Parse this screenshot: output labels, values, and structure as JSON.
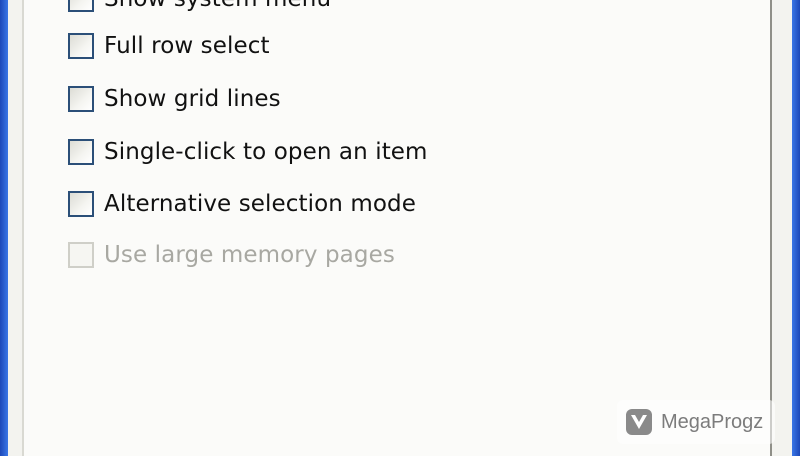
{
  "options": [
    {
      "label": "Show system menu",
      "checked": false,
      "enabled": true
    },
    {
      "label": "Full row select",
      "checked": false,
      "enabled": true
    },
    {
      "label": "Show grid lines",
      "checked": false,
      "enabled": true
    },
    {
      "label": "Single-click to open an item",
      "checked": false,
      "enabled": true
    },
    {
      "label": "Alternative selection mode",
      "checked": false,
      "enabled": true
    },
    {
      "label": "Use large memory pages",
      "checked": false,
      "enabled": false
    }
  ],
  "watermark": {
    "text": "MegaProgz",
    "icon": "megaprogz-logo-icon"
  },
  "colors": {
    "window_frame": "#2a63d8",
    "checkbox_border": "#2b4f78",
    "disabled_text": "#a8a8a2"
  }
}
